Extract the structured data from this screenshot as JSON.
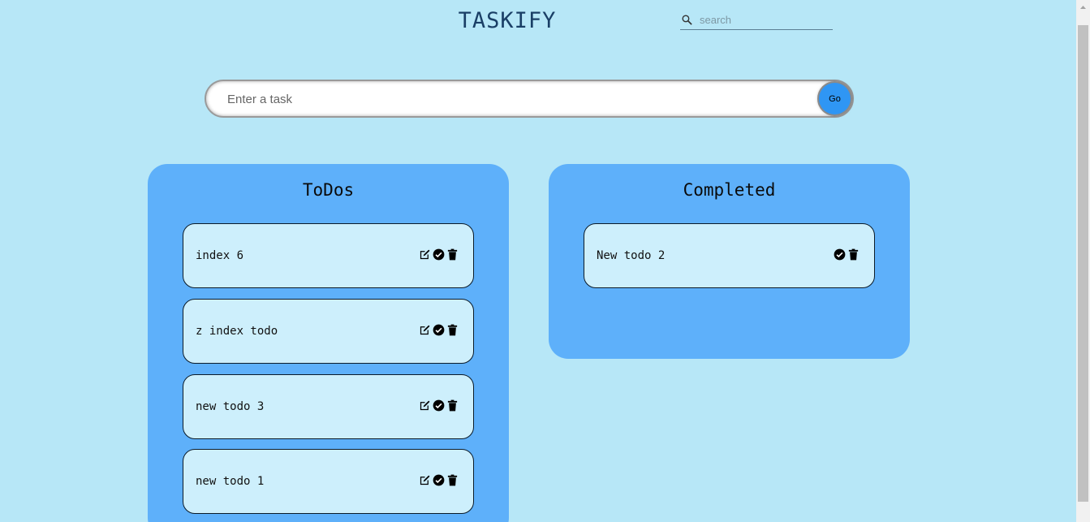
{
  "app": {
    "title": "TASKIFY"
  },
  "search": {
    "placeholder": "search",
    "icon": "search-icon"
  },
  "task_input": {
    "placeholder": "Enter a task",
    "go_label": "Go"
  },
  "todos": {
    "heading": "ToDos",
    "items": [
      {
        "text": "index 6"
      },
      {
        "text": "z index todo"
      },
      {
        "text": "new todo 3"
      },
      {
        "text": "new todo 1"
      }
    ],
    "actions": [
      "edit-icon",
      "check-circle-icon",
      "trash-icon"
    ]
  },
  "completed": {
    "heading": "Completed",
    "items": [
      {
        "text": "New todo 2"
      }
    ],
    "actions": [
      "check-circle-icon",
      "trash-icon"
    ]
  },
  "colors": {
    "background": "#b7e7f7",
    "panel": "#5eb0fa",
    "card": "#cdeffc",
    "go_button": "#2f96f4",
    "title": "#1a3f66"
  }
}
